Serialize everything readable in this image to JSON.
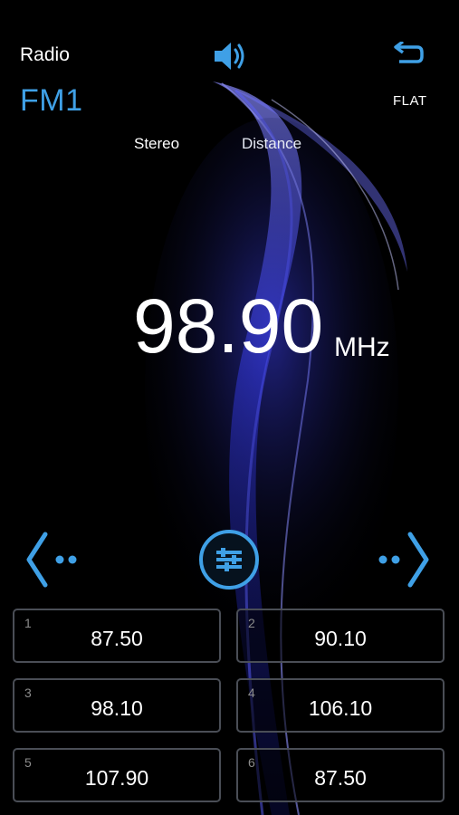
{
  "header": {
    "title": "Radio",
    "band": "FM1",
    "eq_preset": "FLAT",
    "icons": {
      "volume": "speaker-icon",
      "back": "back-arrow-icon"
    }
  },
  "status": {
    "stereo": "Stereo",
    "distance": "Distance"
  },
  "tuner": {
    "frequency": "98.90",
    "unit": "MHz",
    "icons": {
      "prev": "seek-back-icon",
      "next": "seek-forward-icon",
      "tune": "equalizer-sliders-icon"
    }
  },
  "presets": [
    {
      "number": "1",
      "frequency": "87.50"
    },
    {
      "number": "2",
      "frequency": "90.10"
    },
    {
      "number": "3",
      "frequency": "98.10"
    },
    {
      "number": "4",
      "frequency": "106.10"
    },
    {
      "number": "5",
      "frequency": "107.90"
    },
    {
      "number": "6",
      "frequency": "87.50"
    }
  ],
  "colors": {
    "accent": "#3fa0e6",
    "background": "#000000",
    "wave": "#3a3ee8"
  }
}
